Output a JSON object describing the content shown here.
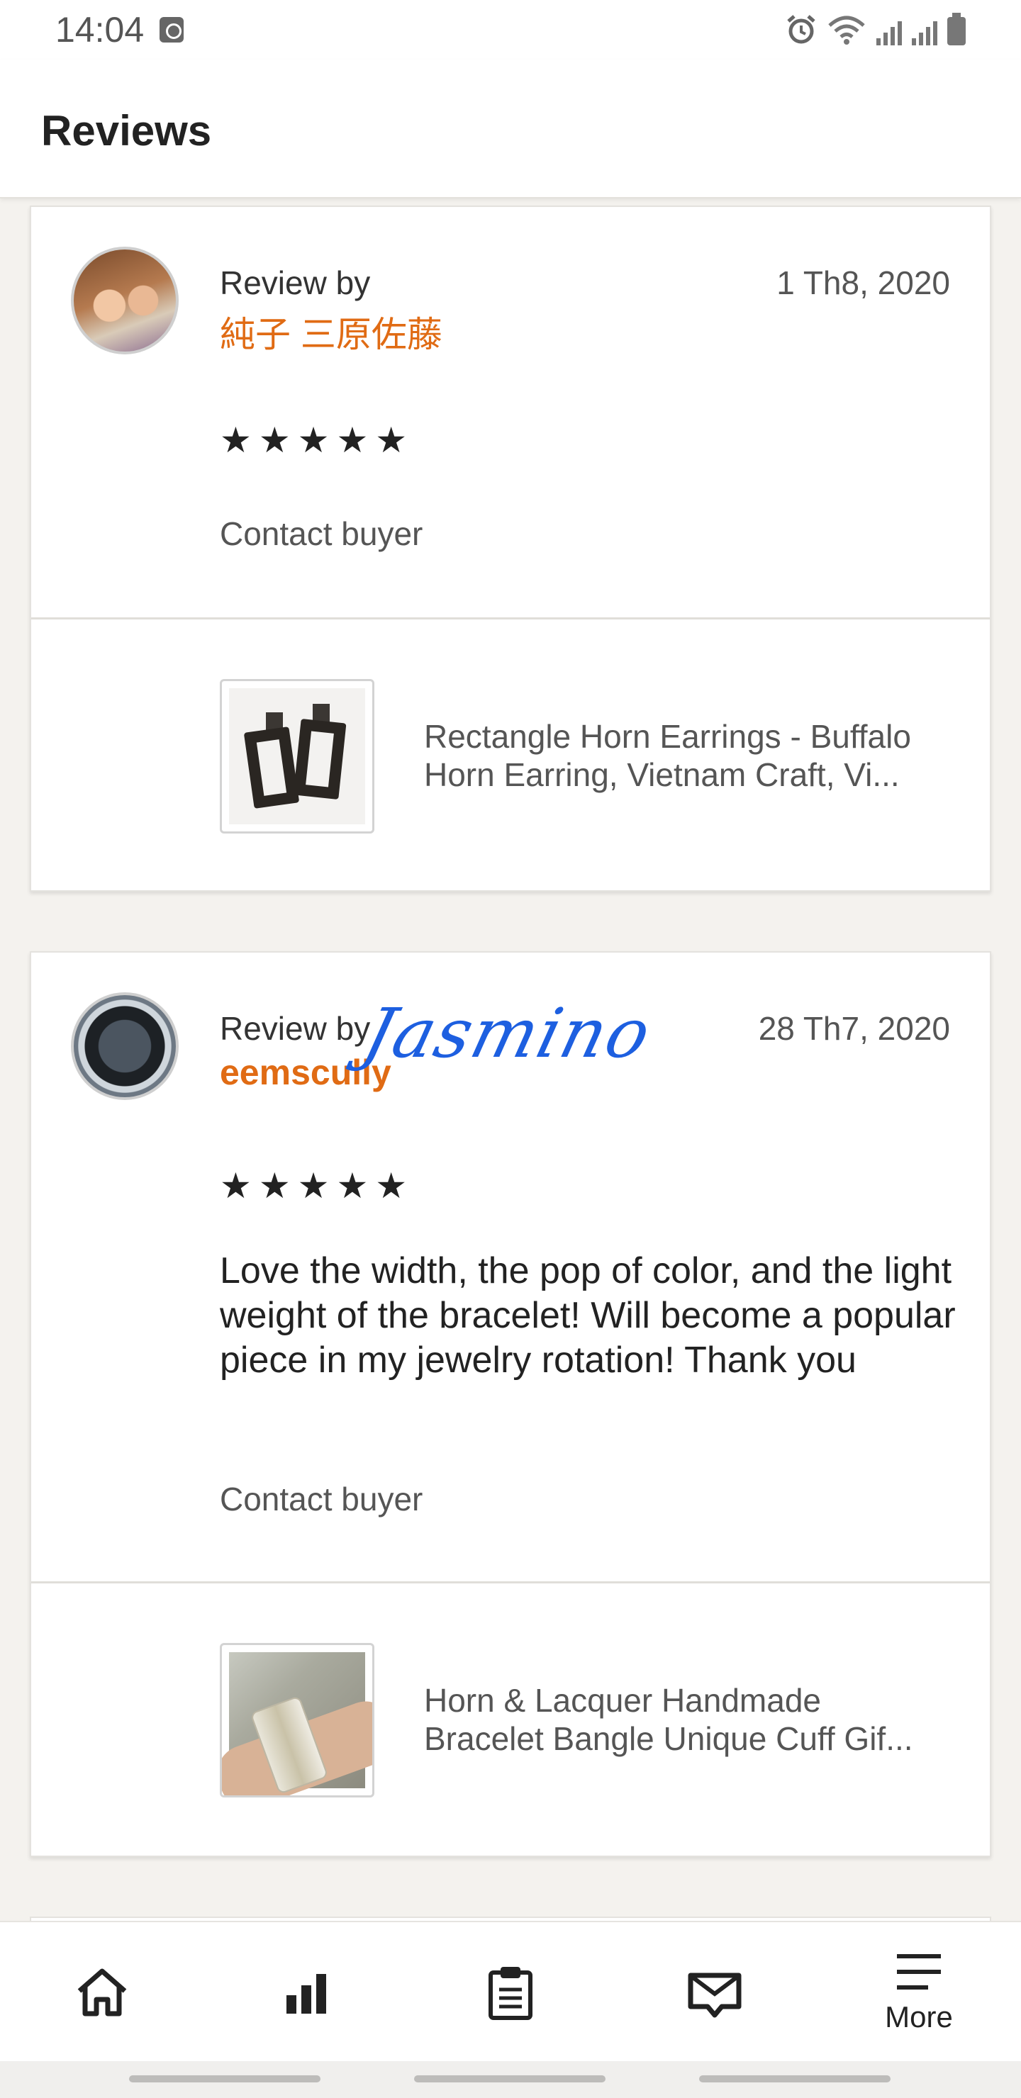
{
  "status_bar": {
    "time": "14:04"
  },
  "header": {
    "title": "Reviews"
  },
  "reviews": [
    {
      "review_by": "Review by",
      "reviewer": "純子 三原佐藤",
      "date": "1 Th8, 2020",
      "stars": "★★★★★",
      "rating": 5,
      "text": "",
      "contact": "Contact buyer",
      "product": {
        "line1": "Rectangle Horn Earrings - Buffalo",
        "line2": "Horn Earring, Vietnam Craft, Vi..."
      }
    },
    {
      "review_by": "Review by",
      "reviewer": "eemscully",
      "date": "28 Th7, 2020",
      "stars": "★★★★★",
      "rating": 5,
      "text": "Love the width, the pop of color, and the light weight of the bracelet! Will become a popular piece in my jewelry rotation! Thank you",
      "contact": "Contact buyer",
      "product": {
        "line1": "Horn & Lacquer Handmade",
        "line2": "Bracelet Bangle Unique Cuff Gif..."
      }
    }
  ],
  "signature_overlay": "Jasmino",
  "bottom_nav": {
    "items": [
      {
        "icon": "home-icon"
      },
      {
        "icon": "stats-icon"
      },
      {
        "icon": "orders-icon"
      },
      {
        "icon": "messages-icon"
      },
      {
        "icon": "menu-icon",
        "label": "More"
      }
    ]
  },
  "colors": {
    "accent": "#e06b14",
    "signature": "#1d5fe0",
    "background": "#f4f2ee"
  }
}
